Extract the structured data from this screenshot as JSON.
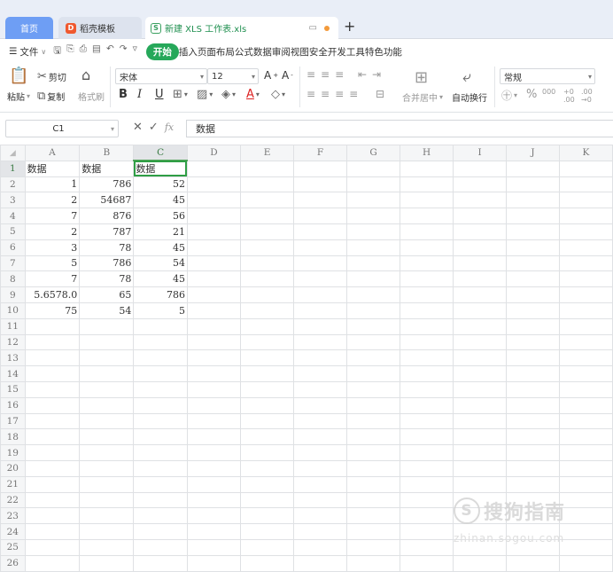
{
  "tabs": [
    {
      "label": "首页"
    },
    {
      "label": "稻壳模板",
      "badge": "D"
    },
    {
      "label": "新建 XLS 工作表.xls",
      "badge": "S"
    }
  ],
  "menu": {
    "file": "文件",
    "start": "开始",
    "items": [
      "插入",
      "页面布局",
      "公式",
      "数据",
      "审阅",
      "视图",
      "安全",
      "开发工具",
      "特色功能"
    ]
  },
  "toolbar": {
    "paste": "粘贴",
    "cut": "剪切",
    "copy": "复制",
    "format_painter": "格式刷",
    "font_name": "宋体",
    "font_size": "12",
    "merge_center": "合并居中",
    "wrap_text": "自动换行",
    "number_format": "常规"
  },
  "formula_bar": {
    "name_box": "C1",
    "fx": "fx",
    "content": "数据"
  },
  "sheet": {
    "columns": [
      "A",
      "B",
      "C",
      "D",
      "E",
      "F",
      "G",
      "H",
      "I",
      "J",
      "K"
    ],
    "active_cell": "C1",
    "rows": [
      [
        "数据",
        "数据",
        "数据"
      ],
      [
        "1",
        "786",
        "52"
      ],
      [
        "2",
        "54687",
        "45"
      ],
      [
        "7",
        "876",
        "56"
      ],
      [
        "2",
        "787",
        "21"
      ],
      [
        "3",
        "78",
        "45"
      ],
      [
        "5",
        "786",
        "54"
      ],
      [
        "7",
        "78",
        "45"
      ],
      [
        "5.6578.0",
        "65",
        "786"
      ],
      [
        "75",
        "54",
        "5"
      ]
    ],
    "row_count": 26
  },
  "watermark": {
    "main": "搜狗指南",
    "sub": "zhinan.sogou.com"
  }
}
